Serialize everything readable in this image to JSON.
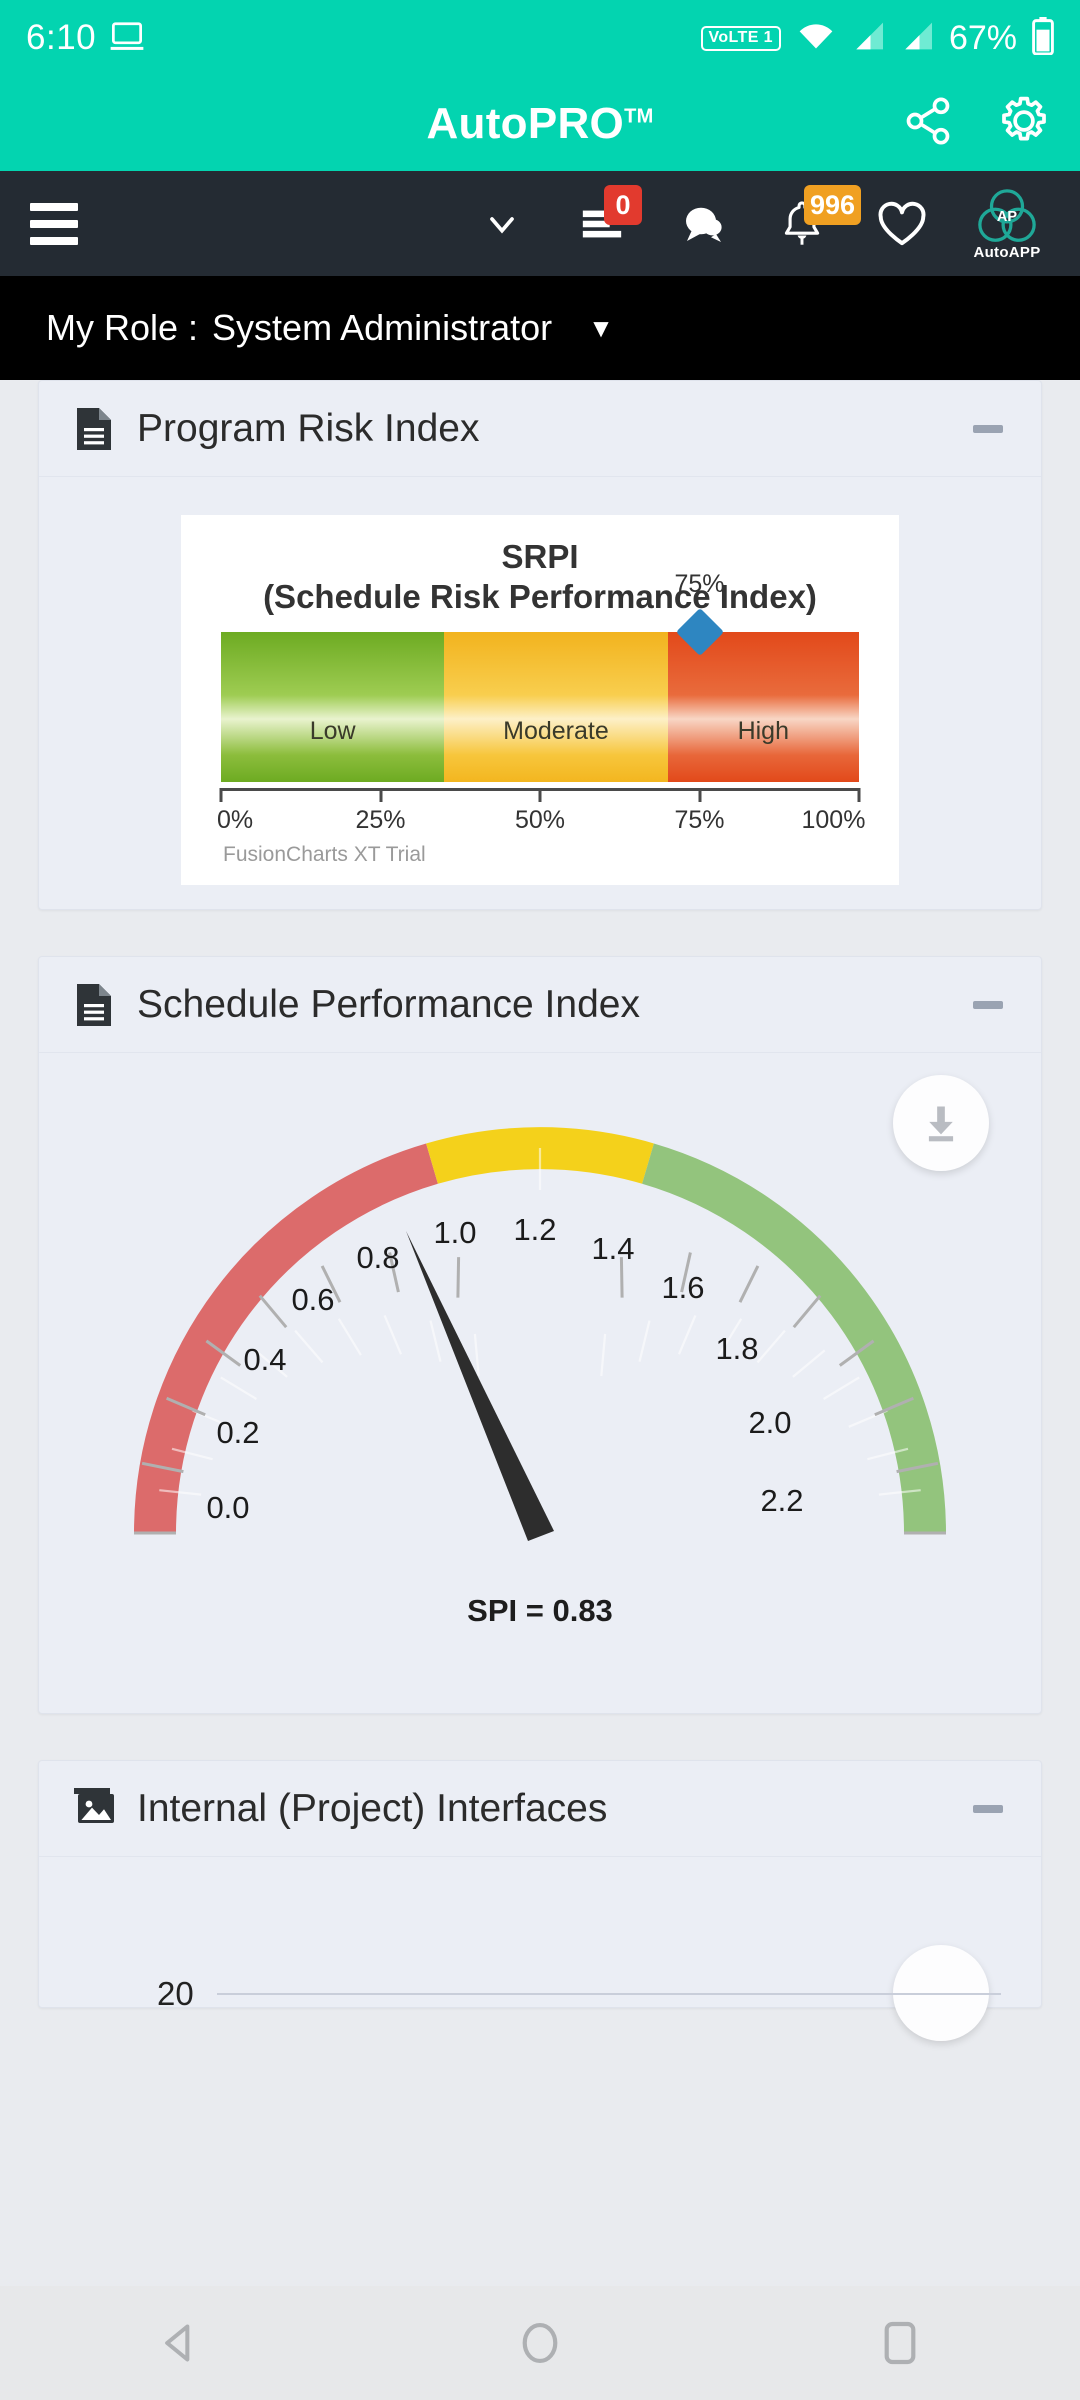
{
  "statusbar": {
    "time": "6:10",
    "cast_icon": "cast-screen-icon",
    "volte_label": "VoLTE 1",
    "wifi_icon": "wifi-icon",
    "signal1_icon": "signal-bars-icon",
    "signal2_icon": "signal-bars-icon",
    "battery_percent": "67%",
    "battery_icon": "battery-icon"
  },
  "appbar": {
    "title": "AutoPRO",
    "trademark": "TM",
    "share_icon": "share-icon",
    "settings_icon": "gear-icon",
    "background_color": "#03D4B0"
  },
  "navbar": {
    "menu_icon": "hamburger-menu-icon",
    "chevron_icon": "chevron-down-icon",
    "background_color": "#242B33",
    "items": [
      {
        "icon": "task-list-icon",
        "badge": "0",
        "badge_color": "#E23A2E"
      },
      {
        "icon": "chat-bubble-icon",
        "badge": "",
        "badge_color": ""
      },
      {
        "icon": "bell-icon",
        "badge": "996",
        "badge_color": "#F0A022"
      },
      {
        "icon": "heart-icon",
        "badge": "",
        "badge_color": ""
      }
    ],
    "logo": {
      "icon": "autoapp-logo-icon",
      "label": "AutoAPP"
    }
  },
  "rolebar": {
    "label": "My Role :",
    "value": "System Administrator",
    "caret": "▼"
  },
  "cards": [
    {
      "icon": "document-icon",
      "title": "Program Risk Index",
      "collapse_label": "collapse"
    },
    {
      "icon": "document-icon",
      "title": "Schedule Performance Index",
      "collapse_label": "collapse",
      "download_icon": "download-icon"
    },
    {
      "icon": "image-icon",
      "title": "Internal (Project) Interfaces",
      "collapse_label": "collapse",
      "partial_axis_value": "20",
      "download_icon": "download-icon"
    }
  ],
  "chart_data": [
    {
      "type": "bar",
      "chart_name": "srpi-bullet-chart",
      "title": "SRPI",
      "subtitle": "(Schedule Risk Performance Index)",
      "xlabel": "",
      "ylabel": "",
      "xlim": [
        0,
        100
      ],
      "grid": false,
      "legend": "none",
      "watermark": "FusionCharts XT Trial",
      "tick_labels": [
        "0%",
        "25%",
        "50%",
        "75%",
        "100%"
      ],
      "ticks": [
        0,
        25,
        50,
        75,
        100
      ],
      "bands": [
        {
          "label": "Low",
          "from": 0,
          "to": 35,
          "color": "#76B82A"
        },
        {
          "label": "Moderate",
          "from": 35,
          "to": 70,
          "color": "#F4BE24"
        },
        {
          "label": "High",
          "from": 70,
          "to": 100,
          "color": "#E2491A"
        }
      ],
      "marker": {
        "value": 75,
        "label": "75%",
        "color": "#2E86C1",
        "shape": "diamond"
      }
    },
    {
      "type": "gauge",
      "chart_name": "spi-angular-gauge",
      "title": "",
      "value": 0.83,
      "value_label": "SPI = 0.83",
      "min": 0.0,
      "max": 2.2,
      "tick_interval": 0.2,
      "tick_labels": [
        "0.0",
        "0.2",
        "0.4",
        "0.6",
        "0.8",
        "1.0",
        "1.2",
        "1.4",
        "1.6",
        "1.8",
        "2.0",
        "2.2"
      ],
      "bands": [
        {
          "from": 0.0,
          "to": 0.9,
          "color": "#DC6B6B"
        },
        {
          "from": 0.9,
          "to": 1.3,
          "color": "#F4D11B"
        },
        {
          "from": 1.3,
          "to": 2.2,
          "color": "#93C47D"
        }
      ],
      "needle_color": "#333333"
    }
  ],
  "androidnav": {
    "back_icon": "back-triangle-icon",
    "home_icon": "home-circle-icon",
    "recents_icon": "recents-square-icon"
  }
}
